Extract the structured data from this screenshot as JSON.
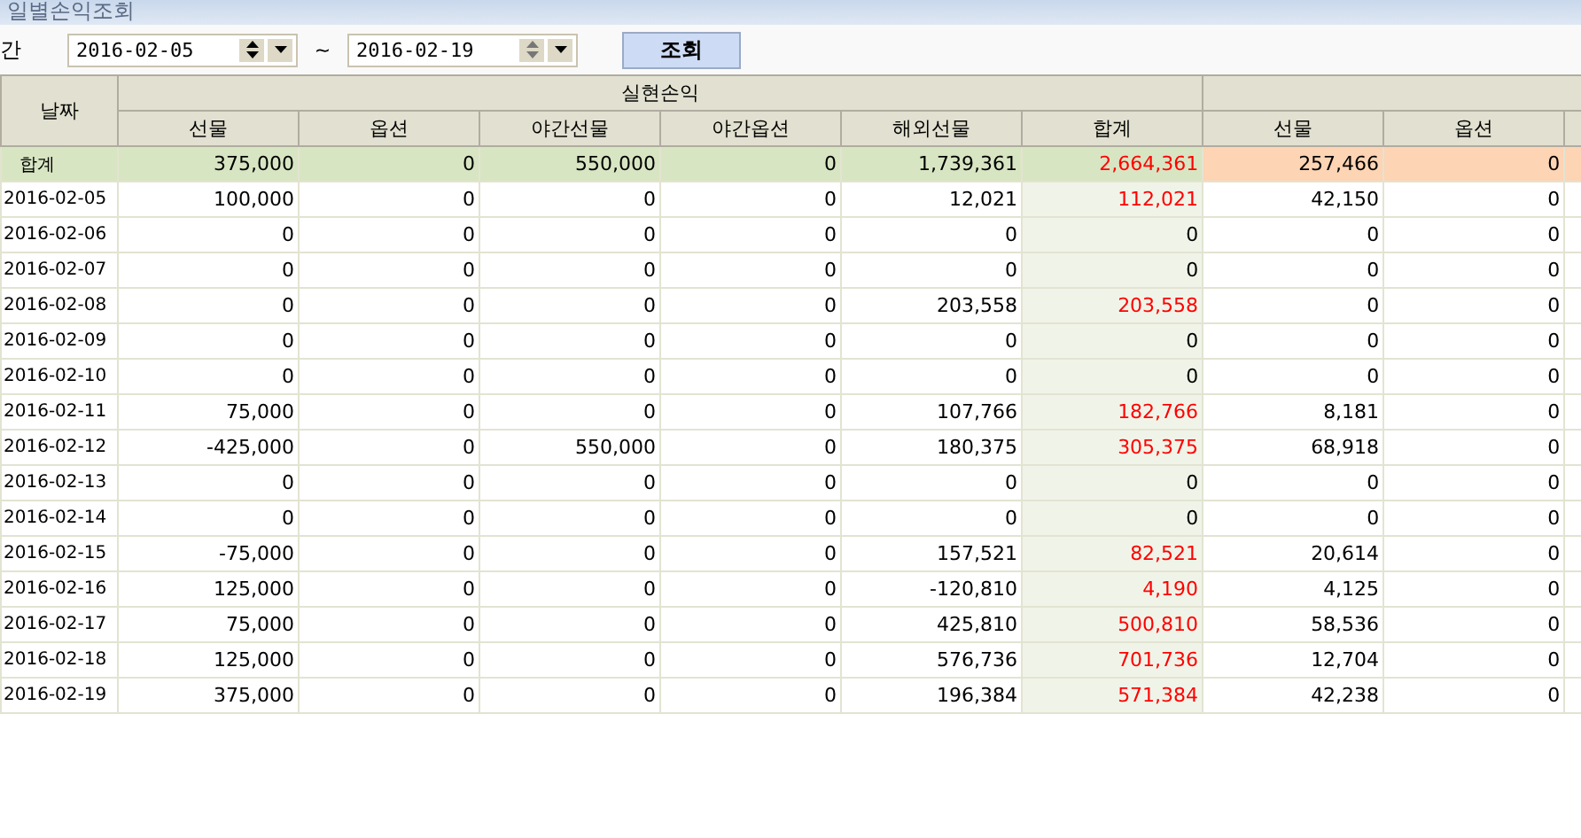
{
  "window": {
    "title": "일별손익조회"
  },
  "filter": {
    "label": "간",
    "from": "2016-02-05",
    "separator": "~",
    "to": "2016-02-19",
    "button": "조회"
  },
  "table": {
    "date_header": "날짜",
    "groups": [
      {
        "label": "실현손익",
        "columns": [
          "선물",
          "옵션",
          "야간선물",
          "야간옵션",
          "해외선물",
          "합계"
        ]
      },
      {
        "columns": [
          "선물",
          "옵션"
        ]
      }
    ],
    "total_row": {
      "label": "합계",
      "cells": [
        "375,000",
        "0",
        "550,000",
        "0",
        "1,739,361",
        "2,664,361",
        "257,466",
        "0"
      ],
      "red_total": true
    },
    "rows": [
      {
        "date": "2016-02-05",
        "cells": [
          "100,000",
          "0",
          "0",
          "0",
          "12,021",
          "112,021",
          "42,150",
          "0"
        ],
        "red_total": true
      },
      {
        "date": "2016-02-06",
        "cells": [
          "0",
          "0",
          "0",
          "0",
          "0",
          "0",
          "0",
          "0"
        ],
        "red_total": false
      },
      {
        "date": "2016-02-07",
        "cells": [
          "0",
          "0",
          "0",
          "0",
          "0",
          "0",
          "0",
          "0"
        ],
        "red_total": false
      },
      {
        "date": "2016-02-08",
        "cells": [
          "0",
          "0",
          "0",
          "0",
          "203,558",
          "203,558",
          "0",
          "0"
        ],
        "red_total": true
      },
      {
        "date": "2016-02-09",
        "cells": [
          "0",
          "0",
          "0",
          "0",
          "0",
          "0",
          "0",
          "0"
        ],
        "red_total": false
      },
      {
        "date": "2016-02-10",
        "cells": [
          "0",
          "0",
          "0",
          "0",
          "0",
          "0",
          "0",
          "0"
        ],
        "red_total": false
      },
      {
        "date": "2016-02-11",
        "cells": [
          "75,000",
          "0",
          "0",
          "0",
          "107,766",
          "182,766",
          "8,181",
          "0"
        ],
        "red_total": true
      },
      {
        "date": "2016-02-12",
        "cells": [
          "-425,000",
          "0",
          "550,000",
          "0",
          "180,375",
          "305,375",
          "68,918",
          "0"
        ],
        "red_total": true
      },
      {
        "date": "2016-02-13",
        "cells": [
          "0",
          "0",
          "0",
          "0",
          "0",
          "0",
          "0",
          "0"
        ],
        "red_total": false
      },
      {
        "date": "2016-02-14",
        "cells": [
          "0",
          "0",
          "0",
          "0",
          "0",
          "0",
          "0",
          "0"
        ],
        "red_total": false
      },
      {
        "date": "2016-02-15",
        "cells": [
          "-75,000",
          "0",
          "0",
          "0",
          "157,521",
          "82,521",
          "20,614",
          "0"
        ],
        "red_total": true
      },
      {
        "date": "2016-02-16",
        "cells": [
          "125,000",
          "0",
          "0",
          "0",
          "-120,810",
          "4,190",
          "4,125",
          "0"
        ],
        "red_total": true
      },
      {
        "date": "2016-02-17",
        "cells": [
          "75,000",
          "0",
          "0",
          "0",
          "425,810",
          "500,810",
          "58,536",
          "0"
        ],
        "red_total": true
      },
      {
        "date": "2016-02-18",
        "cells": [
          "125,000",
          "0",
          "0",
          "0",
          "576,736",
          "701,736",
          "12,704",
          "0"
        ],
        "red_total": true
      },
      {
        "date": "2016-02-19",
        "cells": [
          "375,000",
          "0",
          "0",
          "0",
          "196,384",
          "571,384",
          "42,238",
          "0"
        ],
        "red_total": true
      }
    ]
  }
}
